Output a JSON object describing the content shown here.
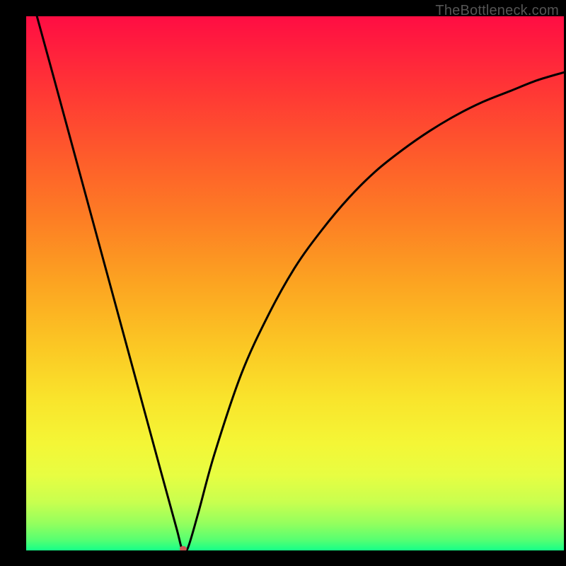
{
  "watermark": "TheBottleneck.com",
  "chart_data": {
    "type": "line",
    "title": "",
    "xlabel": "",
    "ylabel": "",
    "xlim": [
      0,
      100
    ],
    "ylim": [
      0,
      100
    ],
    "grid": false,
    "legend": false,
    "series": [
      {
        "name": "bottleneck-curve",
        "x": [
          2,
          5,
          10,
          15,
          20,
          25,
          28,
          29,
          30,
          32,
          35,
          40,
          45,
          50,
          55,
          60,
          65,
          70,
          75,
          80,
          85,
          90,
          95,
          100
        ],
        "y": [
          100,
          89,
          70.5,
          52,
          33.5,
          15,
          4,
          0.3,
          0.3,
          7,
          18,
          33,
          44,
          53,
          60,
          66,
          71,
          75,
          78.5,
          81.5,
          84,
          86,
          88,
          89.5
        ]
      }
    ],
    "marker": {
      "name": "min-point",
      "x": 29.2,
      "y": 0.3,
      "color": "#cc5555",
      "rx": 5,
      "ry": 4
    },
    "background_gradient": {
      "direction": "top-to-bottom",
      "stops": [
        {
          "pos": 0.0,
          "color": "#ff0d43"
        },
        {
          "pos": 0.05,
          "color": "#ff1c3e"
        },
        {
          "pos": 0.15,
          "color": "#ff3a34"
        },
        {
          "pos": 0.26,
          "color": "#fe5b2b"
        },
        {
          "pos": 0.38,
          "color": "#fd7e24"
        },
        {
          "pos": 0.5,
          "color": "#fca421"
        },
        {
          "pos": 0.62,
          "color": "#fbc824"
        },
        {
          "pos": 0.72,
          "color": "#f9e52c"
        },
        {
          "pos": 0.8,
          "color": "#f4f636"
        },
        {
          "pos": 0.86,
          "color": "#e7fd42"
        },
        {
          "pos": 0.91,
          "color": "#c8ff4f"
        },
        {
          "pos": 0.95,
          "color": "#93ff5e"
        },
        {
          "pos": 0.98,
          "color": "#57ff71"
        },
        {
          "pos": 1.0,
          "color": "#16ff88"
        }
      ]
    }
  }
}
